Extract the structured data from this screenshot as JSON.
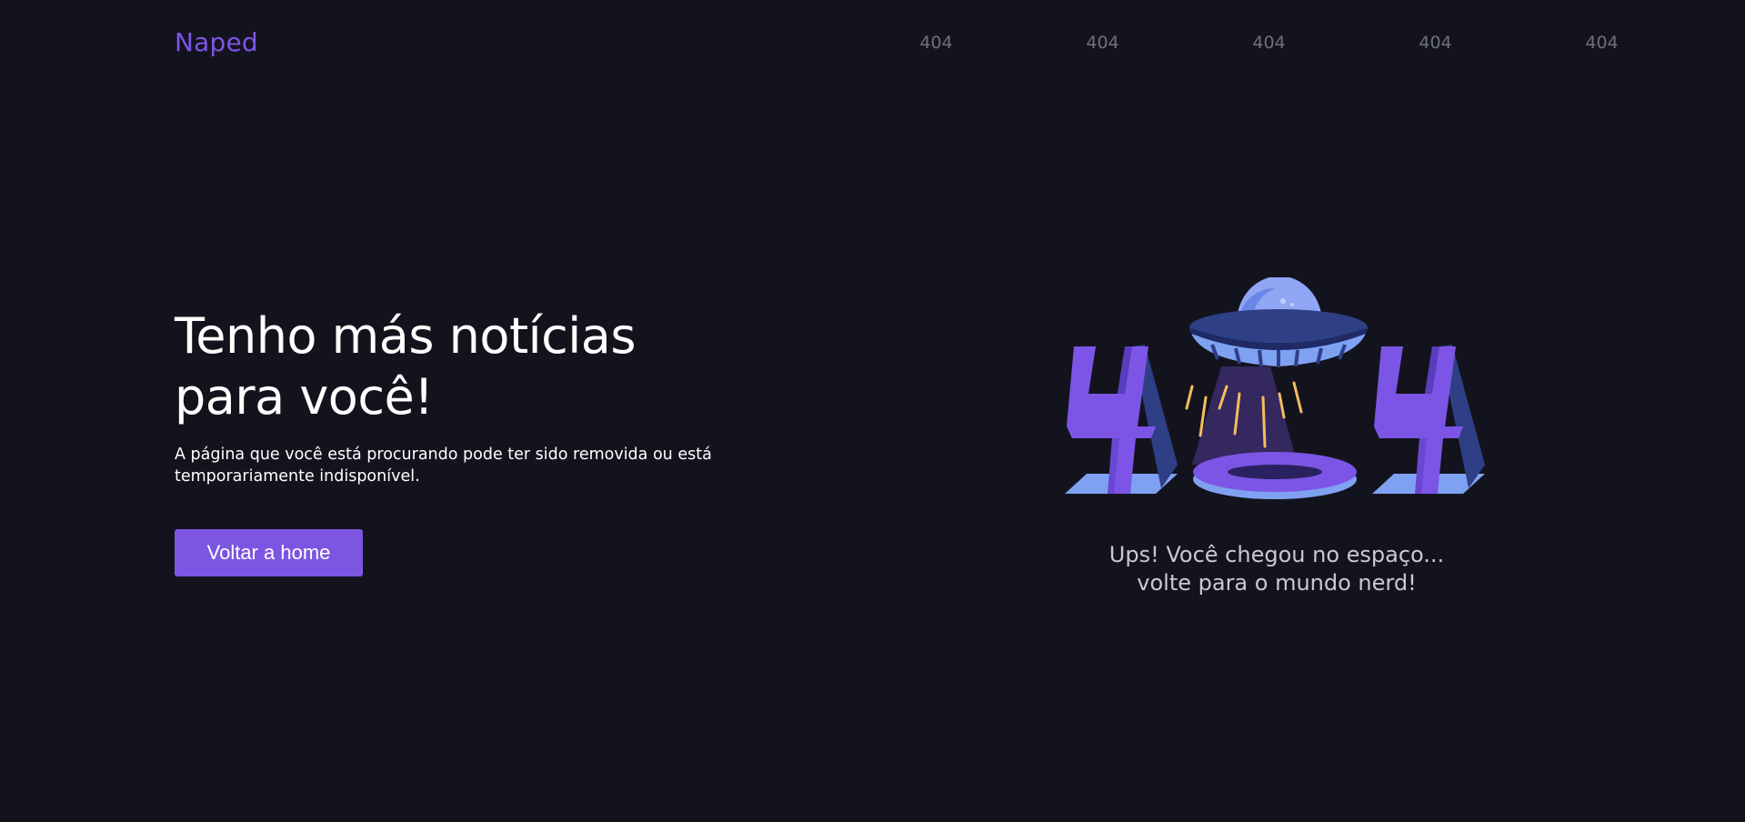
{
  "header": {
    "logo": "Naped",
    "nav_items": [
      "404",
      "404",
      "404",
      "404",
      "404"
    ]
  },
  "hero": {
    "title": "Tenho más notícias para você!",
    "description": "A página que você está procurando pode ter sido removida ou está temporariamente indisponível.",
    "button_label": "Voltar a home"
  },
  "illustration": {
    "icon": "ufo-404-illustration",
    "caption_line1": "Ups! Você chegou no espaço...",
    "caption_line2": "volte para o mundo nerd!"
  },
  "colors": {
    "background": "#13131e",
    "accent": "#7d55e3",
    "nav_text": "#6f707e",
    "caption_text": "#c9c9d2"
  }
}
